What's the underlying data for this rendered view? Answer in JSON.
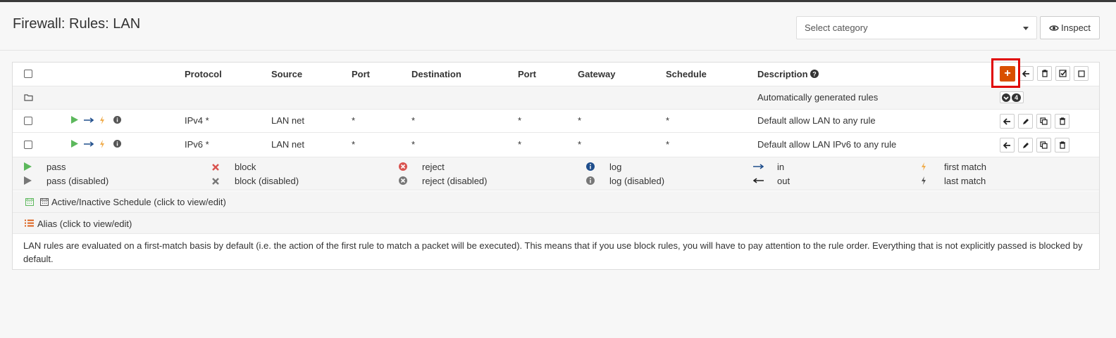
{
  "header": {
    "title": "Firewall: Rules: LAN",
    "category_placeholder": "Select category",
    "inspect_label": "Inspect"
  },
  "table": {
    "columns": [
      "Protocol",
      "Source",
      "Port",
      "Destination",
      "Port",
      "Gateway",
      "Schedule",
      "Description"
    ],
    "auto_rules_label": "Automatically generated rules",
    "auto_rules_count": "4",
    "rows": [
      {
        "protocol": "IPv4 *",
        "source": "LAN net",
        "src_port": "*",
        "destination": "*",
        "dst_port": "*",
        "gateway": "*",
        "schedule": "*",
        "description": "Default allow LAN to any rule"
      },
      {
        "protocol": "IPv6 *",
        "source": "LAN net",
        "src_port": "*",
        "destination": "*",
        "dst_port": "*",
        "gateway": "*",
        "schedule": "*",
        "description": "Default allow LAN IPv6 to any rule"
      }
    ]
  },
  "legend": {
    "pass": "pass",
    "pass_disabled": "pass (disabled)",
    "block": "block",
    "block_disabled": "block (disabled)",
    "reject": "reject",
    "reject_disabled": "reject (disabled)",
    "log": "log",
    "log_disabled": "log (disabled)",
    "in": "in",
    "out": "out",
    "first_match": "first match",
    "last_match": "last match"
  },
  "notes": {
    "schedule": "Active/Inactive Schedule (click to view/edit)",
    "alias": "Alias (click to view/edit)",
    "help": "LAN rules are evaluated on a first-match basis by default (i.e. the action of the first rule to match a packet will be executed). This means that if you use block rules, you will have to pay attention to the rule order. Everything that is not explicitly passed is blocked by default."
  },
  "colors": {
    "pass": "#5cb85c",
    "block": "#d9534f",
    "direction": "#1f4e8c",
    "first_match": "#f0ad4e",
    "info": "#555555",
    "add_button": "#d94f00",
    "highlight": "#e00000"
  },
  "icons": {
    "inspect": "eye-icon",
    "folder": "folder-icon",
    "add": "plus-icon",
    "move": "arrow-left-icon",
    "delete": "trash-icon",
    "enable": "check-square-icon",
    "disable": "square-icon",
    "edit": "pencil-icon",
    "clone": "clone-icon",
    "schedule": "calendar-icon",
    "alias": "list-icon",
    "help": "question-circle-icon"
  }
}
